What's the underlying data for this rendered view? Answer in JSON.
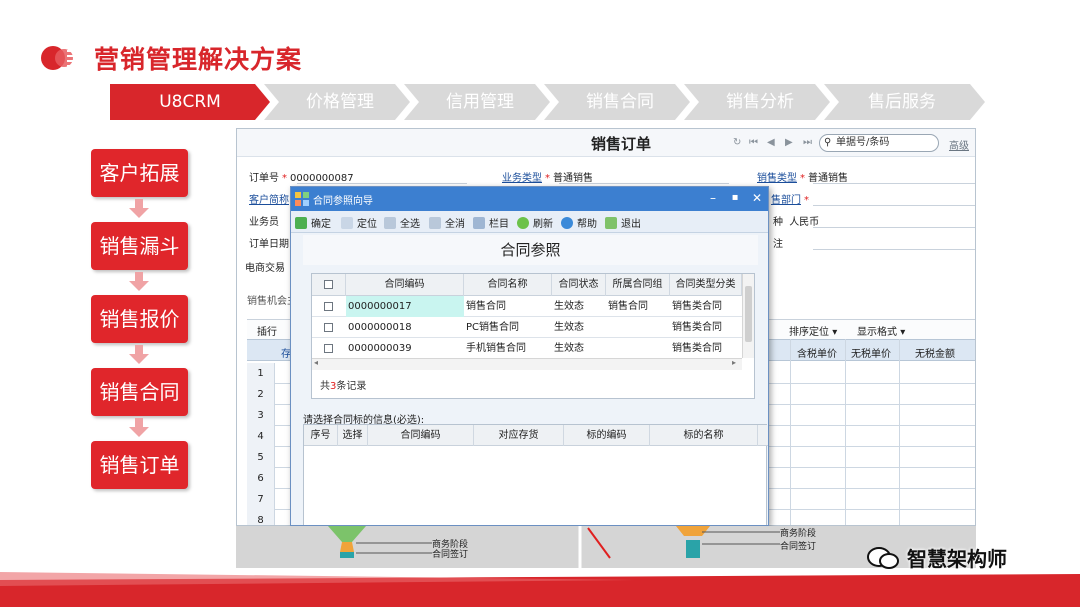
{
  "slide": {
    "title": "营销管理解决方案"
  },
  "steps": [
    {
      "label": "U8CRM",
      "active": true
    },
    {
      "label": "价格管理",
      "active": false
    },
    {
      "label": "信用管理",
      "active": false
    },
    {
      "label": "销售合同",
      "active": false
    },
    {
      "label": "销售分析",
      "active": false
    },
    {
      "label": "售后服务",
      "active": false
    }
  ],
  "flow": [
    "客户拓展",
    "销售漏斗",
    "销售报价",
    "销售合同",
    "销售订单"
  ],
  "order": {
    "title": "销售订单",
    "search_placeholder": "单据号/条码",
    "advanced": "高级",
    "order_no_label": "订单号",
    "order_no": "0000000087",
    "biz_type_label": "业务类型",
    "biz_type": "普通销售",
    "sales_type_label": "销售类型",
    "sales_type": "普通销售",
    "customer_label": "客户简称",
    "dept_label": "售部门",
    "salesman_label": "业务员",
    "currency_prefix": "种",
    "currency": "人民币",
    "order_date_label": "订单日期",
    "rate_label": "注",
    "ecommerce_label": "电商交易",
    "opportunity_label": "销售机会主",
    "grid_toolbar": {
      "insert": "插行",
      "sort": "排序定位",
      "format": "显示格式"
    },
    "grid_columns": {
      "stock": "存",
      "tax_price": "含税单价",
      "notax_price": "无税单价",
      "notax_amount": "无税金额"
    },
    "rows": [
      "1",
      "2",
      "3",
      "4",
      "5",
      "6",
      "7",
      "8"
    ]
  },
  "dialog": {
    "title": "合同参照向导",
    "toolbar": [
      "确定",
      "定位",
      "全选",
      "全消",
      "栏目",
      "刷新",
      "帮助",
      "退出"
    ],
    "heading": "合同参照",
    "columns": [
      "合同编码",
      "合同名称",
      "合同状态",
      "所属合同组",
      "合同类型分类"
    ],
    "rows": [
      {
        "code": "0000000017",
        "name": "销售合同",
        "status": "生效态",
        "group": "销售合同",
        "type": "销售类合同"
      },
      {
        "code": "0000000018",
        "name": "PC销售合同",
        "status": "生效态",
        "group": "",
        "type": "销售类合同"
      },
      {
        "code": "0000000039",
        "name": "手机销售合同",
        "status": "生效态",
        "group": "",
        "type": "销售类合同"
      }
    ],
    "record_prefix": "共",
    "record_count": "3",
    "record_suffix": "条记录",
    "prompt": "请选择合同标的信息(必选):",
    "sub_columns": [
      "序号",
      "选择",
      "合同编码",
      "对应存货",
      "标的编码",
      "标的名称"
    ]
  },
  "funnel": {
    "stage1": "商务阶段",
    "stage2": "合同签订"
  },
  "watermark": "智慧架构师",
  "colors": {
    "brand_red": "#d8262b",
    "step_grey": "#d9d9d9",
    "dialog_blue": "#3c7fd0",
    "highlight_cyan": "#c9f5f0"
  }
}
